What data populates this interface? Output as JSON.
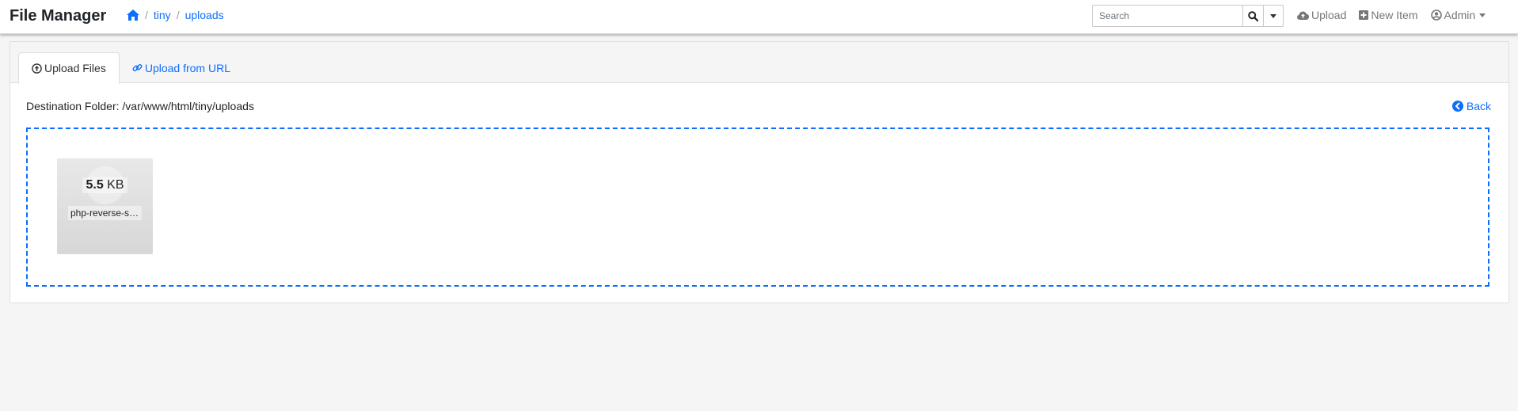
{
  "app": {
    "title": "File Manager"
  },
  "breadcrumb": {
    "home_icon": "home-icon",
    "items": [
      "tiny",
      "uploads"
    ],
    "separator": "/"
  },
  "search": {
    "placeholder": "Search",
    "value": ""
  },
  "nav": {
    "upload_label": "Upload",
    "new_item_label": "New Item",
    "admin_label": "Admin"
  },
  "tabs": [
    {
      "label": "Upload Files",
      "icon": "arrow-circle-up-icon",
      "active": true
    },
    {
      "label": "Upload from URL",
      "icon": "link-icon",
      "active": false
    }
  ],
  "destination": {
    "text": "Destination Folder: /var/www/html/tiny/uploads"
  },
  "back": {
    "label": "Back"
  },
  "file": {
    "size_number": "5.5",
    "size_unit": "KB",
    "name": "php-reverse-shell.php"
  },
  "colors": {
    "accent": "#0d6efd",
    "muted": "#777777",
    "background": "#f5f5f5"
  }
}
